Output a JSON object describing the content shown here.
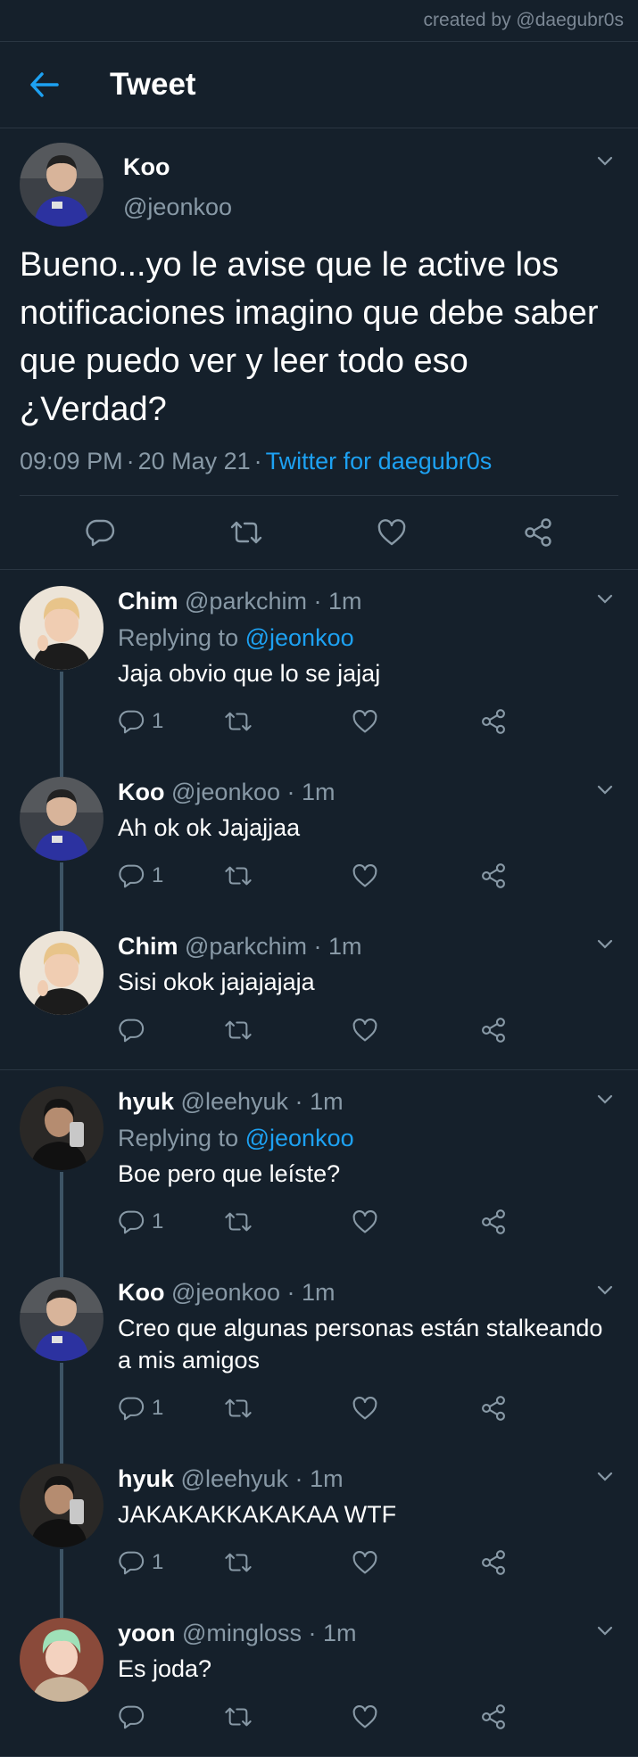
{
  "credit": "created by @daegubr0s",
  "header": {
    "title": "Tweet"
  },
  "main": {
    "name": "Koo",
    "handle": "@jeonkoo",
    "text": "Bueno...yo le avise que le active los notificaciones imagino que debe saber que puedo ver y leer todo eso ¿Verdad?",
    "time": "09:09 PM",
    "date": "20 May 21",
    "client": "Twitter for daegubr0s"
  },
  "replies": [
    {
      "name": "Chim",
      "handle": "@parkchim",
      "time": "1m",
      "replying_label": "Replying to",
      "replying_to": "@jeonkoo",
      "text": "Jaja obvio que lo se jajaj",
      "reply_count": "1"
    },
    {
      "name": "Koo",
      "handle": "@jeonkoo",
      "time": "1m",
      "text": "Ah ok ok Jajajjaa",
      "reply_count": "1"
    },
    {
      "name": "Chim",
      "handle": "@parkchim",
      "time": "1m",
      "text": "Sisi okok jajajajaja",
      "reply_count": ""
    },
    {
      "name": "hyuk",
      "handle": "@leehyuk",
      "time": "1m",
      "replying_label": "Replying to",
      "replying_to": "@jeonkoo",
      "text": "Boe pero que leíste?",
      "reply_count": "1"
    },
    {
      "name": "Koo",
      "handle": "@jeonkoo",
      "time": "1m",
      "text": "Creo que algunas personas están stalkeando a mis amigos",
      "reply_count": "1"
    },
    {
      "name": "hyuk",
      "handle": "@leehyuk",
      "time": "1m",
      "text": "JAKAKAKKAKAKAA WTF",
      "reply_count": "1"
    },
    {
      "name": "yoon",
      "handle": "@mingloss",
      "time": "1m",
      "text": "Es joda?",
      "reply_count": ""
    }
  ],
  "separator": "·",
  "colors": {
    "background": "#15202b",
    "accent": "#1da1f2",
    "muted": "#8899a6",
    "divider": "#2a3642"
  },
  "icons": [
    "back-arrow-icon",
    "chevron-down-icon",
    "reply-icon",
    "retweet-icon",
    "like-icon",
    "share-icon"
  ]
}
